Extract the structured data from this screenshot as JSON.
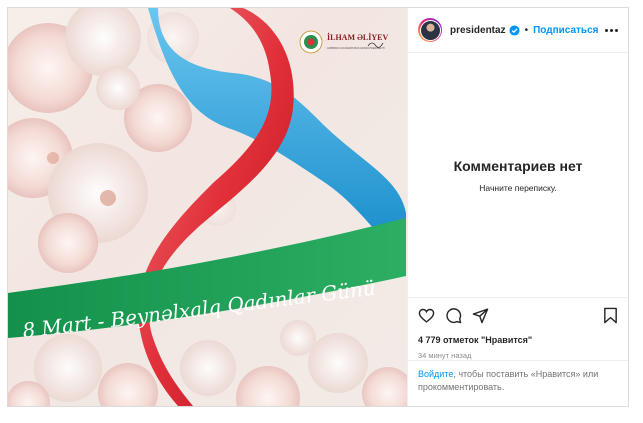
{
  "post": {
    "image": {
      "headline": "8 Mart - Beynəlxalq Qadınlar Günü",
      "logo_name": "İLHAM ƏLİYEV",
      "logo_subtitle": "AZƏRBAYCAN RESPUBLİKASININ PREZİDENTİ"
    },
    "colors": {
      "ribbon_green": "#1e9c56",
      "ribbon_red": "#e1303a",
      "ribbon_blue": "#1a9dd9"
    }
  },
  "header": {
    "username": "presidentaz",
    "separator": "•",
    "follow_label": "Подписаться"
  },
  "comments": {
    "empty_title": "Комментариев нет",
    "empty_subtitle": "Начните переписку."
  },
  "stats": {
    "likes": "4 779 отметок \"Нравится\"",
    "time": "34 минут назад"
  },
  "footer": {
    "login_link": "Войдите",
    "login_text": ", чтобы поставить «Нравится» или прокомментировать."
  },
  "icons": [
    "verified-icon",
    "more-icon",
    "heart-icon",
    "comment-icon",
    "share-icon",
    "bookmark-icon"
  ]
}
